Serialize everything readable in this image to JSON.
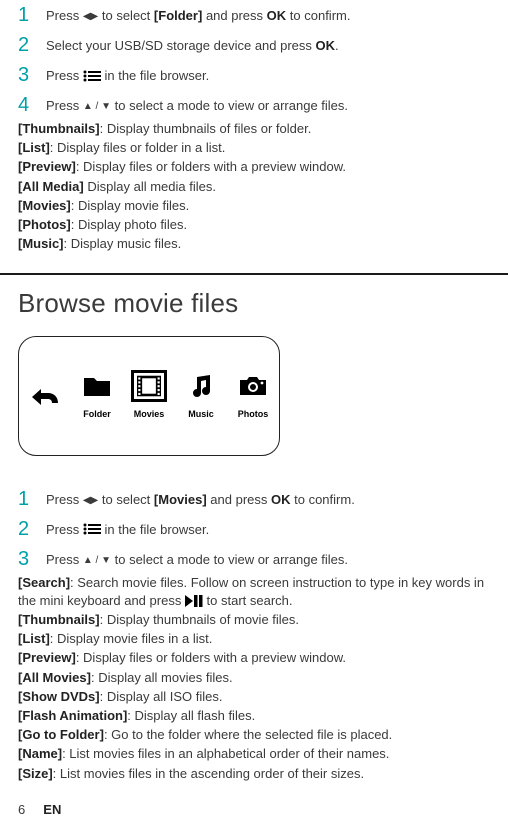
{
  "sectionA": {
    "steps": [
      {
        "n": "1",
        "pre": "Press",
        "glyph": "◀▶",
        "mid": "to select",
        "bold": "[Folder]",
        "mid2": "and press",
        "bold2": "OK",
        "post": "to confirm."
      },
      {
        "n": "2",
        "text_pre": "Select your USB/SD storage device and press",
        "bold": "OK",
        "post": "."
      },
      {
        "n": "3",
        "text_pre": "Press",
        "icon": "menu",
        "post": "in the file browser."
      },
      {
        "n": "4",
        "text_pre": "Press",
        "glyph": "▲ / ▼",
        "post": "to select a mode to view or arrange files."
      }
    ],
    "items": [
      {
        "k": "[Thumbnails]",
        "v": ": Display thumbnails of files or folder."
      },
      {
        "k": "[List]",
        "v": ": Display files or folder in a list."
      },
      {
        "k": "[Preview]",
        "v": ": Display files or folders with a preview window."
      },
      {
        "k": "[All Media]",
        "v": " Display all media files."
      },
      {
        "k": "[Movies]",
        "v": ": Display movie files."
      },
      {
        "k": "[Photos]",
        "v": ": Display photo files."
      },
      {
        "k": "[Music]",
        "v": ": Display music files."
      }
    ]
  },
  "sectionB": {
    "title": "Browse movie files",
    "illus": {
      "items": [
        {
          "icon": "back",
          "label": ""
        },
        {
          "icon": "folder",
          "label": "Folder"
        },
        {
          "icon": "movies",
          "label": "Movies",
          "selected": true
        },
        {
          "icon": "music",
          "label": "Music"
        },
        {
          "icon": "camera",
          "label": "Photos"
        }
      ]
    },
    "steps": [
      {
        "n": "1",
        "pre": "Press",
        "glyph": "◀▶",
        "mid": "to select",
        "bold": "[Movies]",
        "mid2": "and press",
        "bold2": "OK",
        "post": "to confirm."
      },
      {
        "n": "2",
        "text_pre": "Press",
        "icon": "menu",
        "post": "in the file browser."
      },
      {
        "n": "3",
        "text_pre": "Press",
        "glyph": "▲ / ▼",
        "post": "to select a mode to view or arrange files."
      }
    ],
    "items": [
      {
        "k": "[Search]",
        "pre": ": Search movie files. Follow on screen instruction to type in key words in the mini keyboard and press ",
        "icon": "playpause",
        "post": " to start search."
      },
      {
        "k": "[Thumbnails]",
        "v": ": Display thumbnails of movie files."
      },
      {
        "k": "[List]",
        "v": ": Display movie files in a list."
      },
      {
        "k": "[Preview]",
        "v": ": Display files or folders with a preview window."
      },
      {
        "k": "[All Movies]",
        "v": ": Display all movies files."
      },
      {
        "k": "[Show DVDs]",
        "v": ": Display all ISO files."
      },
      {
        "k": "[Flash Animation]",
        "v": ": Display all flash files."
      },
      {
        "k": "[Go to Folder]",
        "v": ": Go to the folder where the selected file is placed."
      },
      {
        "k": "[Name]",
        "v": ": List movies files in an alphabetical order of their names."
      },
      {
        "k": "[Size]",
        "v": ": List movies files in the ascending order of their sizes."
      }
    ]
  },
  "footer": {
    "page": "6",
    "lang": "EN"
  }
}
